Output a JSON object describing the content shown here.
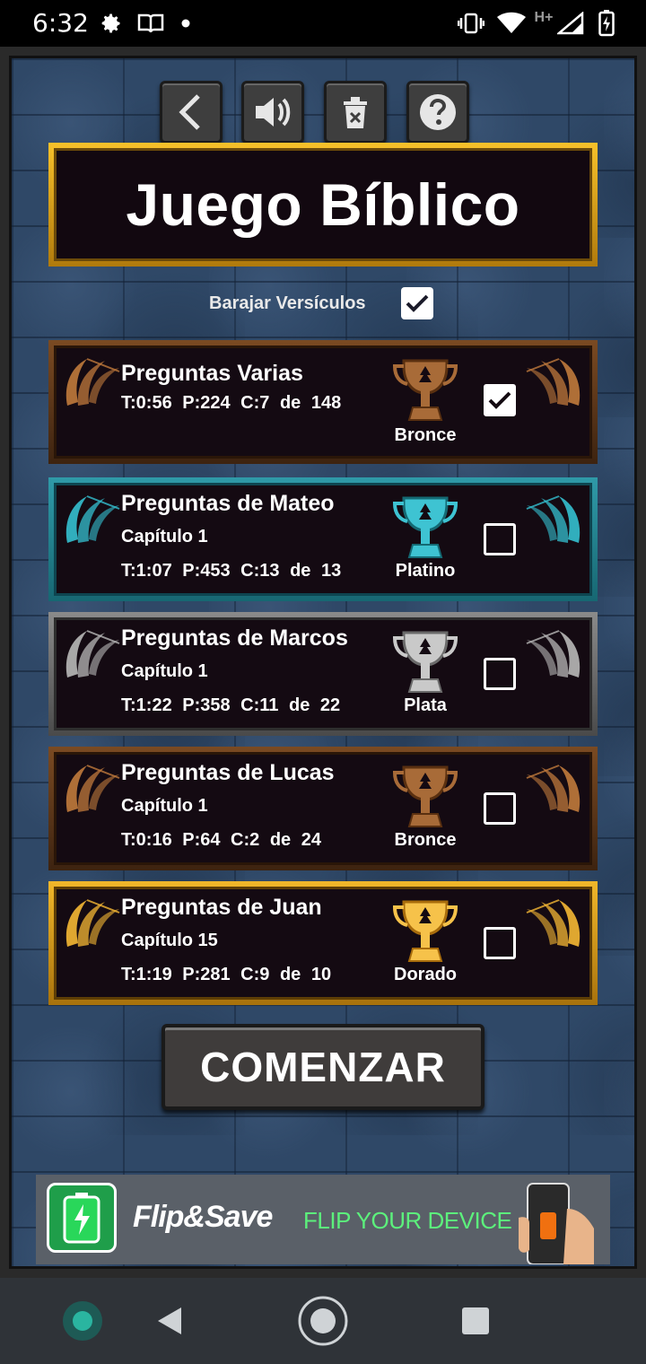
{
  "status_bar": {
    "time": "6:32",
    "left_icons": [
      "gear-icon",
      "book-icon",
      "dot-icon"
    ],
    "right_icons": [
      "vibrate-icon",
      "wifi-icon",
      "signal-icon",
      "battery-icon"
    ],
    "network": "H+"
  },
  "toolbar": {
    "buttons": [
      "back",
      "sound",
      "delete",
      "help"
    ]
  },
  "title": "Juego Bíblico",
  "shuffle": {
    "label": "Barajar Versículos",
    "checked": true
  },
  "cards": [
    {
      "title": "Preguntas Varias",
      "subtitle": "",
      "stats": "T:0:56  P:224  C:7  de  148",
      "medal": "Bronce",
      "theme": "bronce",
      "checked": true
    },
    {
      "title": "Preguntas de Mateo",
      "subtitle": "Capítulo 1",
      "stats": "T:1:07  P:453  C:13  de  13",
      "medal": "Platino",
      "theme": "platino",
      "checked": false
    },
    {
      "title": "Preguntas de Marcos",
      "subtitle": "Capítulo 1",
      "stats": "T:1:22  P:358  C:11  de  22",
      "medal": "Plata",
      "theme": "plata",
      "checked": false
    },
    {
      "title": "Preguntas de Lucas",
      "subtitle": "Capítulo 1",
      "stats": "T:0:16  P:64  C:2  de  24",
      "medal": "Bronce",
      "theme": "bronce",
      "checked": false
    },
    {
      "title": "Preguntas de Juan",
      "subtitle": "Capítulo 15",
      "stats": "T:1:19  P:281  C:9  de  10",
      "medal": "Dorado",
      "theme": "dorado",
      "checked": false
    }
  ],
  "start_button": "COMENZAR",
  "ad": {
    "brand": "Flip&Save",
    "tagline": "FLIP YOUR DEVICE"
  },
  "colors": {
    "bronce": "#8a5a30",
    "platino": "#2aa3b2",
    "plata": "#9a9a9a",
    "dorado": "#f2b52a"
  },
  "nav": [
    "assistant-dot-icon",
    "back-triangle-icon",
    "home-circle-icon",
    "recents-square-icon"
  ]
}
